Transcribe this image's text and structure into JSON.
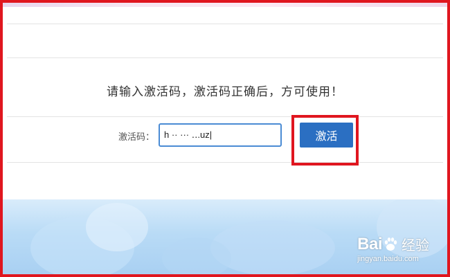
{
  "page": {
    "message": "请输入激活码，激活码正确后，方可使用！"
  },
  "form": {
    "code_label": "激活码：",
    "code_value": "h ·· ··· ‥.uz|",
    "activate_label": "激活"
  },
  "watermark": {
    "logo_left": "Bai",
    "logo_right": "经验",
    "url": "jingyan.baidu.com"
  },
  "colors": {
    "highlight": "#e0161f",
    "button": "#2b6fc2",
    "input_border": "#4a8bd4"
  }
}
